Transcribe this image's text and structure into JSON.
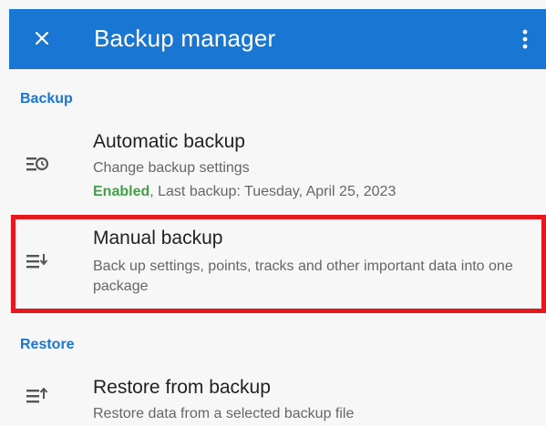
{
  "appbar": {
    "title": "Backup manager",
    "close_icon": "close-icon",
    "more_icon": "more-vert-icon",
    "color": "#1976d2"
  },
  "sections": {
    "backup": "Backup",
    "restore": "Restore"
  },
  "items": {
    "automatic": {
      "title": "Automatic backup",
      "subtitle": "Change backup settings",
      "status_enabled": "Enabled",
      "status_rest": ", Last backup: Tuesday, April 25, 2023",
      "icon": "backup-schedule-icon"
    },
    "manual": {
      "title": "Manual backup",
      "subtitle": "Back up settings, points, tracks and other important data into one package",
      "icon": "list-download-icon"
    },
    "restore": {
      "title": "Restore from backup",
      "subtitle": "Restore data from a selected backup file",
      "icon": "list-upload-icon"
    }
  },
  "colors": {
    "accent": "#1976d2",
    "enabled": "#43a047",
    "highlight": "#e5181f"
  }
}
